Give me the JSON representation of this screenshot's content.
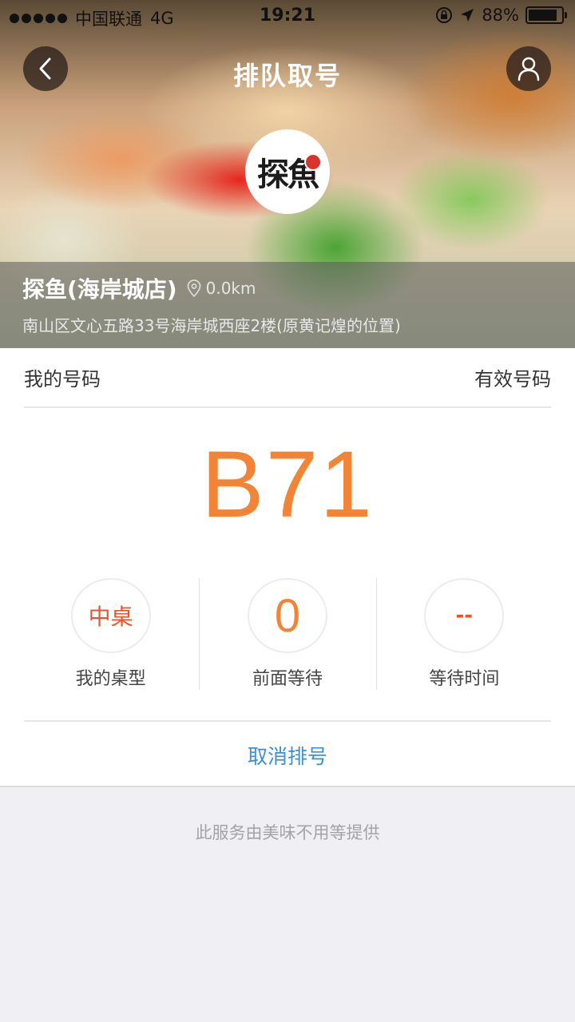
{
  "status_bar": {
    "carrier": "中国联通",
    "network": "4G",
    "time": "19:21",
    "battery_text": "88%",
    "battery_level": 0.88
  },
  "nav": {
    "title": "排队取号",
    "back_icon": "chevron-left-icon",
    "user_icon": "user-icon"
  },
  "shop": {
    "logo_text": "探魚",
    "name": "探鱼(海岸城店)",
    "distance": "0.0km",
    "address": "南山区文心五路33号海岸城西座2楼(原黄记煌的位置)"
  },
  "ticket": {
    "my_number_label": "我的号码",
    "status_label": "有效号码",
    "number": "B71",
    "stats": [
      {
        "value": "中桌",
        "label": "我的桌型"
      },
      {
        "value": "0",
        "label": "前面等待"
      },
      {
        "value": "--",
        "label": "等待时间"
      }
    ],
    "cancel_label": "取消排号"
  },
  "footer": {
    "provider_text": "此服务由美味不用等提供"
  },
  "colors": {
    "accent_orange": "#f28435",
    "accent_red": "#e8552d",
    "link_blue": "#3b8fd3"
  }
}
